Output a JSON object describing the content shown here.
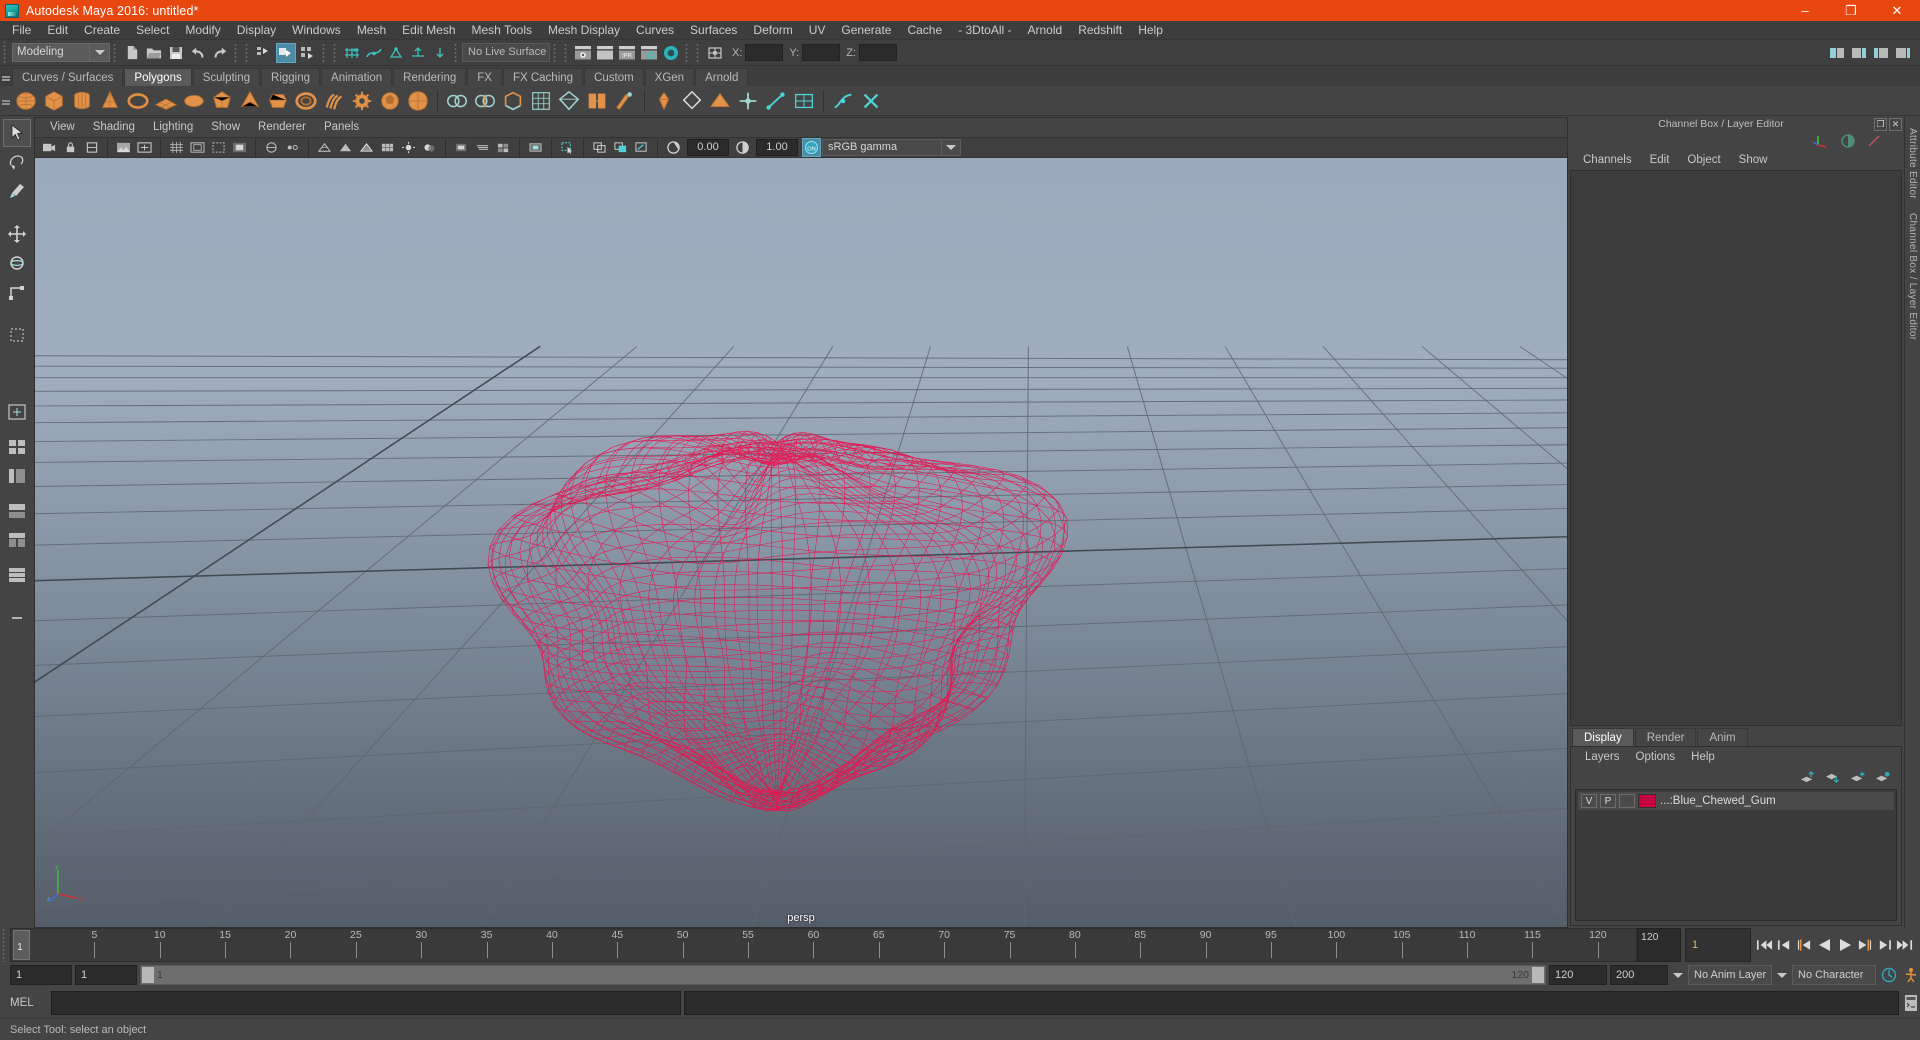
{
  "window": {
    "title": "Autodesk Maya 2016: untitled*",
    "minimize_label": "–",
    "maximize_label": "❐",
    "close_label": "✕",
    "accent_color": "#e8470f"
  },
  "menubar": {
    "items": [
      "File",
      "Edit",
      "Create",
      "Select",
      "Modify",
      "Display",
      "Windows",
      "Mesh",
      "Edit Mesh",
      "Mesh Tools",
      "Mesh Display",
      "Curves",
      "Surfaces",
      "Deform",
      "UV",
      "Generate",
      "Cache",
      "- 3DtoAll -",
      "Arnold",
      "Redshift",
      "Help"
    ]
  },
  "statusbar": {
    "mode": "Modeling",
    "live_surface": "No Live Surface",
    "coord_x_label": "X:",
    "coord_y_label": "Y:",
    "coord_z_label": "Z:",
    "coord_x_value": "",
    "coord_y_value": "",
    "coord_z_value": "",
    "icons": [
      "new-scene-icon",
      "open-scene-icon",
      "save-scene-icon",
      "undo-icon",
      "redo-icon",
      "select-by-hierarchy-icon",
      "select-by-object-icon",
      "select-by-component-icon",
      "snap-to-grid-icon",
      "snap-to-curve-icon",
      "snap-to-point-icon",
      "snap-to-projected-icon",
      "snap-to-view-plane-icon",
      "render-view-icon",
      "render-sequence-icon",
      "ipr-render-icon",
      "render-settings-icon",
      "hypershade-icon"
    ]
  },
  "shelf": {
    "tabs": [
      "Curves / Surfaces",
      "Polygons",
      "Sculpting",
      "Rigging",
      "Animation",
      "Rendering",
      "FX",
      "FX Caching",
      "Custom",
      "XGen",
      "Arnold"
    ],
    "active_tab": "Polygons",
    "buttons": [
      "poly-sphere-icon",
      "poly-cube-icon",
      "poly-cylinder-icon",
      "poly-cone-icon",
      "poly-torus-icon",
      "poly-plane-icon",
      "poly-disc-icon",
      "poly-platonic-icon",
      "poly-pyramid-icon",
      "poly-prism-icon",
      "poly-pipe-icon",
      "poly-helix-icon",
      "poly-gear-icon",
      "poly-soccer-ball-icon",
      "poly-super-ellipse-icon",
      "combine-icon",
      "separate-icon",
      "booleans-icon",
      "extrude-icon",
      "bevel-icon",
      "bridge-icon",
      "append-polygon-icon",
      "sculpt-geometry-icon",
      "smooth-icon",
      "mirror-icon",
      "multi-cut-icon",
      "target-weld-icon",
      "quad-draw-icon",
      "crease-tool-icon",
      "poly-reduce-icon"
    ]
  },
  "toolbox": {
    "tools": [
      {
        "name": "select-tool",
        "active": true
      },
      {
        "name": "lasso-select-tool",
        "active": false
      },
      {
        "name": "paint-select-tool",
        "active": false
      },
      {
        "name": "move-tool",
        "active": false
      },
      {
        "name": "rotate-tool",
        "active": false
      },
      {
        "name": "scale-tool",
        "active": false
      },
      {
        "name": "last-tool-used",
        "active": false
      },
      {
        "name": "single-perspective-layout",
        "active": false
      },
      {
        "name": "four-view-layout",
        "active": false
      },
      {
        "name": "persp-outliner-layout",
        "active": false
      },
      {
        "name": "persp-graph-layout",
        "active": false
      },
      {
        "name": "persp-hypershade-layout",
        "active": false
      },
      {
        "name": "persp-two-stacked-layout",
        "active": false
      },
      {
        "name": "add-layout-bookmark",
        "active": false
      }
    ]
  },
  "viewport": {
    "panel_menu": [
      "View",
      "Shading",
      "Lighting",
      "Show",
      "Renderer",
      "Panels"
    ],
    "toolbar": {
      "exposure_value": "0.00",
      "gamma_value": "1.00",
      "color_management": "sRGB gamma",
      "color_management_enabled_label": "ON",
      "icons": [
        "select-camera-icon",
        "lock-camera-icon",
        "bookmark-icon",
        "image-plane-icon",
        "grid-toggle-icon",
        "film-gate-icon",
        "resolution-gate-icon",
        "gate-mask-icon",
        "xray-toggle-icon",
        "xray-joints-icon",
        "shaded-mode-icon",
        "wireframe-mode-icon",
        "textured-mode-icon",
        "lighting-toggle-icon",
        "shadows-toggle-icon",
        "screen-space-ao-icon",
        "motion-blur-icon",
        "multisample-icon",
        "depth-of-field-icon",
        "isolate-select-icon",
        "xray-active-icon",
        "exposure-icon",
        "gamma-icon"
      ]
    },
    "camera_label": "persp",
    "axis_labels": {
      "x": "x",
      "y": "y",
      "z": "z"
    },
    "object_wireframe_color": "#e01a4f",
    "background_top": "#93a3b5",
    "background_bottom": "#58616c"
  },
  "channel_box": {
    "panel_title": "Channel Box / Layer Editor",
    "menus": [
      "Channels",
      "Edit",
      "Object",
      "Show"
    ],
    "float_button": "❐",
    "close_button": "✕",
    "header_icons": [
      "channel-box-icon",
      "attribute-editor-icon",
      "modeling-toolkit-icon"
    ],
    "content": ""
  },
  "layer_editor": {
    "tabs": [
      "Display",
      "Render",
      "Anim"
    ],
    "active_tab": "Display",
    "menus": [
      "Layers",
      "Options",
      "Help"
    ],
    "toolbar_icons": [
      "move-layer-up-icon",
      "move-layer-down-icon",
      "create-empty-layer-icon",
      "create-layer-from-selected-icon"
    ],
    "layers": [
      {
        "visibility": "V",
        "playback": "P",
        "shading": "",
        "color": "#c7003f",
        "name": "...:Blue_Chewed_Gum"
      }
    ]
  },
  "attribute_strip": {
    "labels": [
      "Attribute Editor",
      "Channel Box / Layer Editor"
    ]
  },
  "time_slider": {
    "start_display": "1",
    "current_frame": "1",
    "end_display": "120",
    "current_frame_field": "1",
    "tick_labels": [
      "5",
      "10",
      "15",
      "20",
      "25",
      "30",
      "35",
      "40",
      "45",
      "50",
      "55",
      "60",
      "65",
      "70",
      "75",
      "80",
      "85",
      "90",
      "95",
      "100",
      "105",
      "110",
      "115",
      "120"
    ],
    "playback_icons": [
      "go-to-start-icon",
      "step-back-keyframe-icon",
      "step-back-frame-icon",
      "play-backwards-icon",
      "play-forwards-icon",
      "step-forward-frame-icon",
      "step-forward-keyframe-icon",
      "go-to-end-icon"
    ]
  },
  "range_slider": {
    "anim_start": "1",
    "range_start": "1",
    "range_track_start": "1",
    "range_track_end": "120",
    "range_end": "120",
    "anim_end": "200",
    "anim_layer": "No Anim Layer",
    "character_set": "No Character Set",
    "auto_key_icon": "auto-keyframe-icon",
    "anim_prefs_icon": "animation-preferences-icon"
  },
  "command_line": {
    "language_label": "MEL",
    "input_value": "",
    "output_value": "",
    "script_editor_icon": "script-editor-icon"
  },
  "help_line": {
    "text": "Select Tool: select an object"
  }
}
